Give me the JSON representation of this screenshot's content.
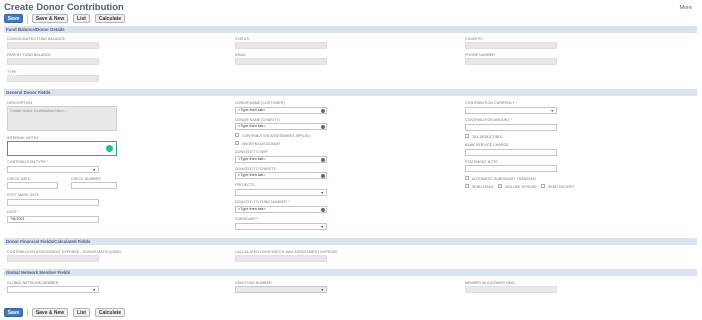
{
  "page": {
    "title": "Create Donor Contribution",
    "more_label": "More"
  },
  "toolbar": {
    "save": "Save",
    "save_new": "Save & New",
    "list": "List",
    "calculate": "Calculate"
  },
  "sections": {
    "fund_balance": "Fund Balance/Donor Details",
    "general": "General Donor Fields",
    "financial": "Donor Financial Fields/Calculated Fields",
    "network": "Global Network Member Fields"
  },
  "fund_balance": {
    "consolidated_fund_balance": "Consolidated Fund Balance",
    "parent_fund_balance": "Parent Fund Balance",
    "type": "Type",
    "status": "Status",
    "email": "Email",
    "country": "Country",
    "phone": "Phone Number"
  },
  "general": {
    "description_label": "Description",
    "description_placeholder": "Create Donor Contribution Here...",
    "internal_notes_label": "Internal Notes",
    "contribution_type_label": "Contribution Type",
    "check_date_label": "Check Date",
    "check_number_label": "Check Number",
    "post_mark_date_label": "Post Mark Date",
    "date_label": "Date",
    "date_value": "7/8/2021",
    "donor_name_customer_label": "Donor Name (Customer)",
    "donor_name_customer_value": "<Type then tab>",
    "donor_name_charity_label": "Donor Name (Charity)",
    "donor_name_charity_value": "<Type then tab>",
    "contribution_assessment_label": "Contribution Assessment Applied",
    "anonymous_donor_label": "Anonymous Donor",
    "donated_to_gmf_label": "Donated to GMF",
    "donated_to_gmf_value": "<Type then tab>",
    "donated_to_charity_label": "Donated to Charity",
    "donated_to_charity_value": "<Type then tab>",
    "projects_label": "Projects",
    "donated_to_fund_number_label": "Donated to Fund Number",
    "donated_to_fund_number_value": "<Type then tab>",
    "subsidiary_label": "Subsidiary",
    "contribution_currency_label": "Contribution Currency",
    "contribution_amount_label": "Contribution Amount",
    "tax_deductible_label": "Tax Deductible",
    "bank_service_charge_label": "Bank Service Charge",
    "statement_note_label": "Statement Note",
    "automatic_subsidiary_transfer_label": "Automatic Subsidiary Transfer",
    "send_email_label": "Send Email",
    "include_spouse_label": "Include Spouse",
    "send_receipt_label": "Send Receipt"
  },
  "financial": {
    "contribution_assessment_expense_label": "Contribution Assessment Expense - Donor Match(GMA)",
    "calculated_over_match_label": "Calculated Over Match-Max Assessment Expense"
  },
  "network": {
    "global_network_member_label": "Global Network Member",
    "gnm_fund_number_label": "GNM Fund Number",
    "member_aka_label": "Member AKA (Donor DBA)"
  }
}
